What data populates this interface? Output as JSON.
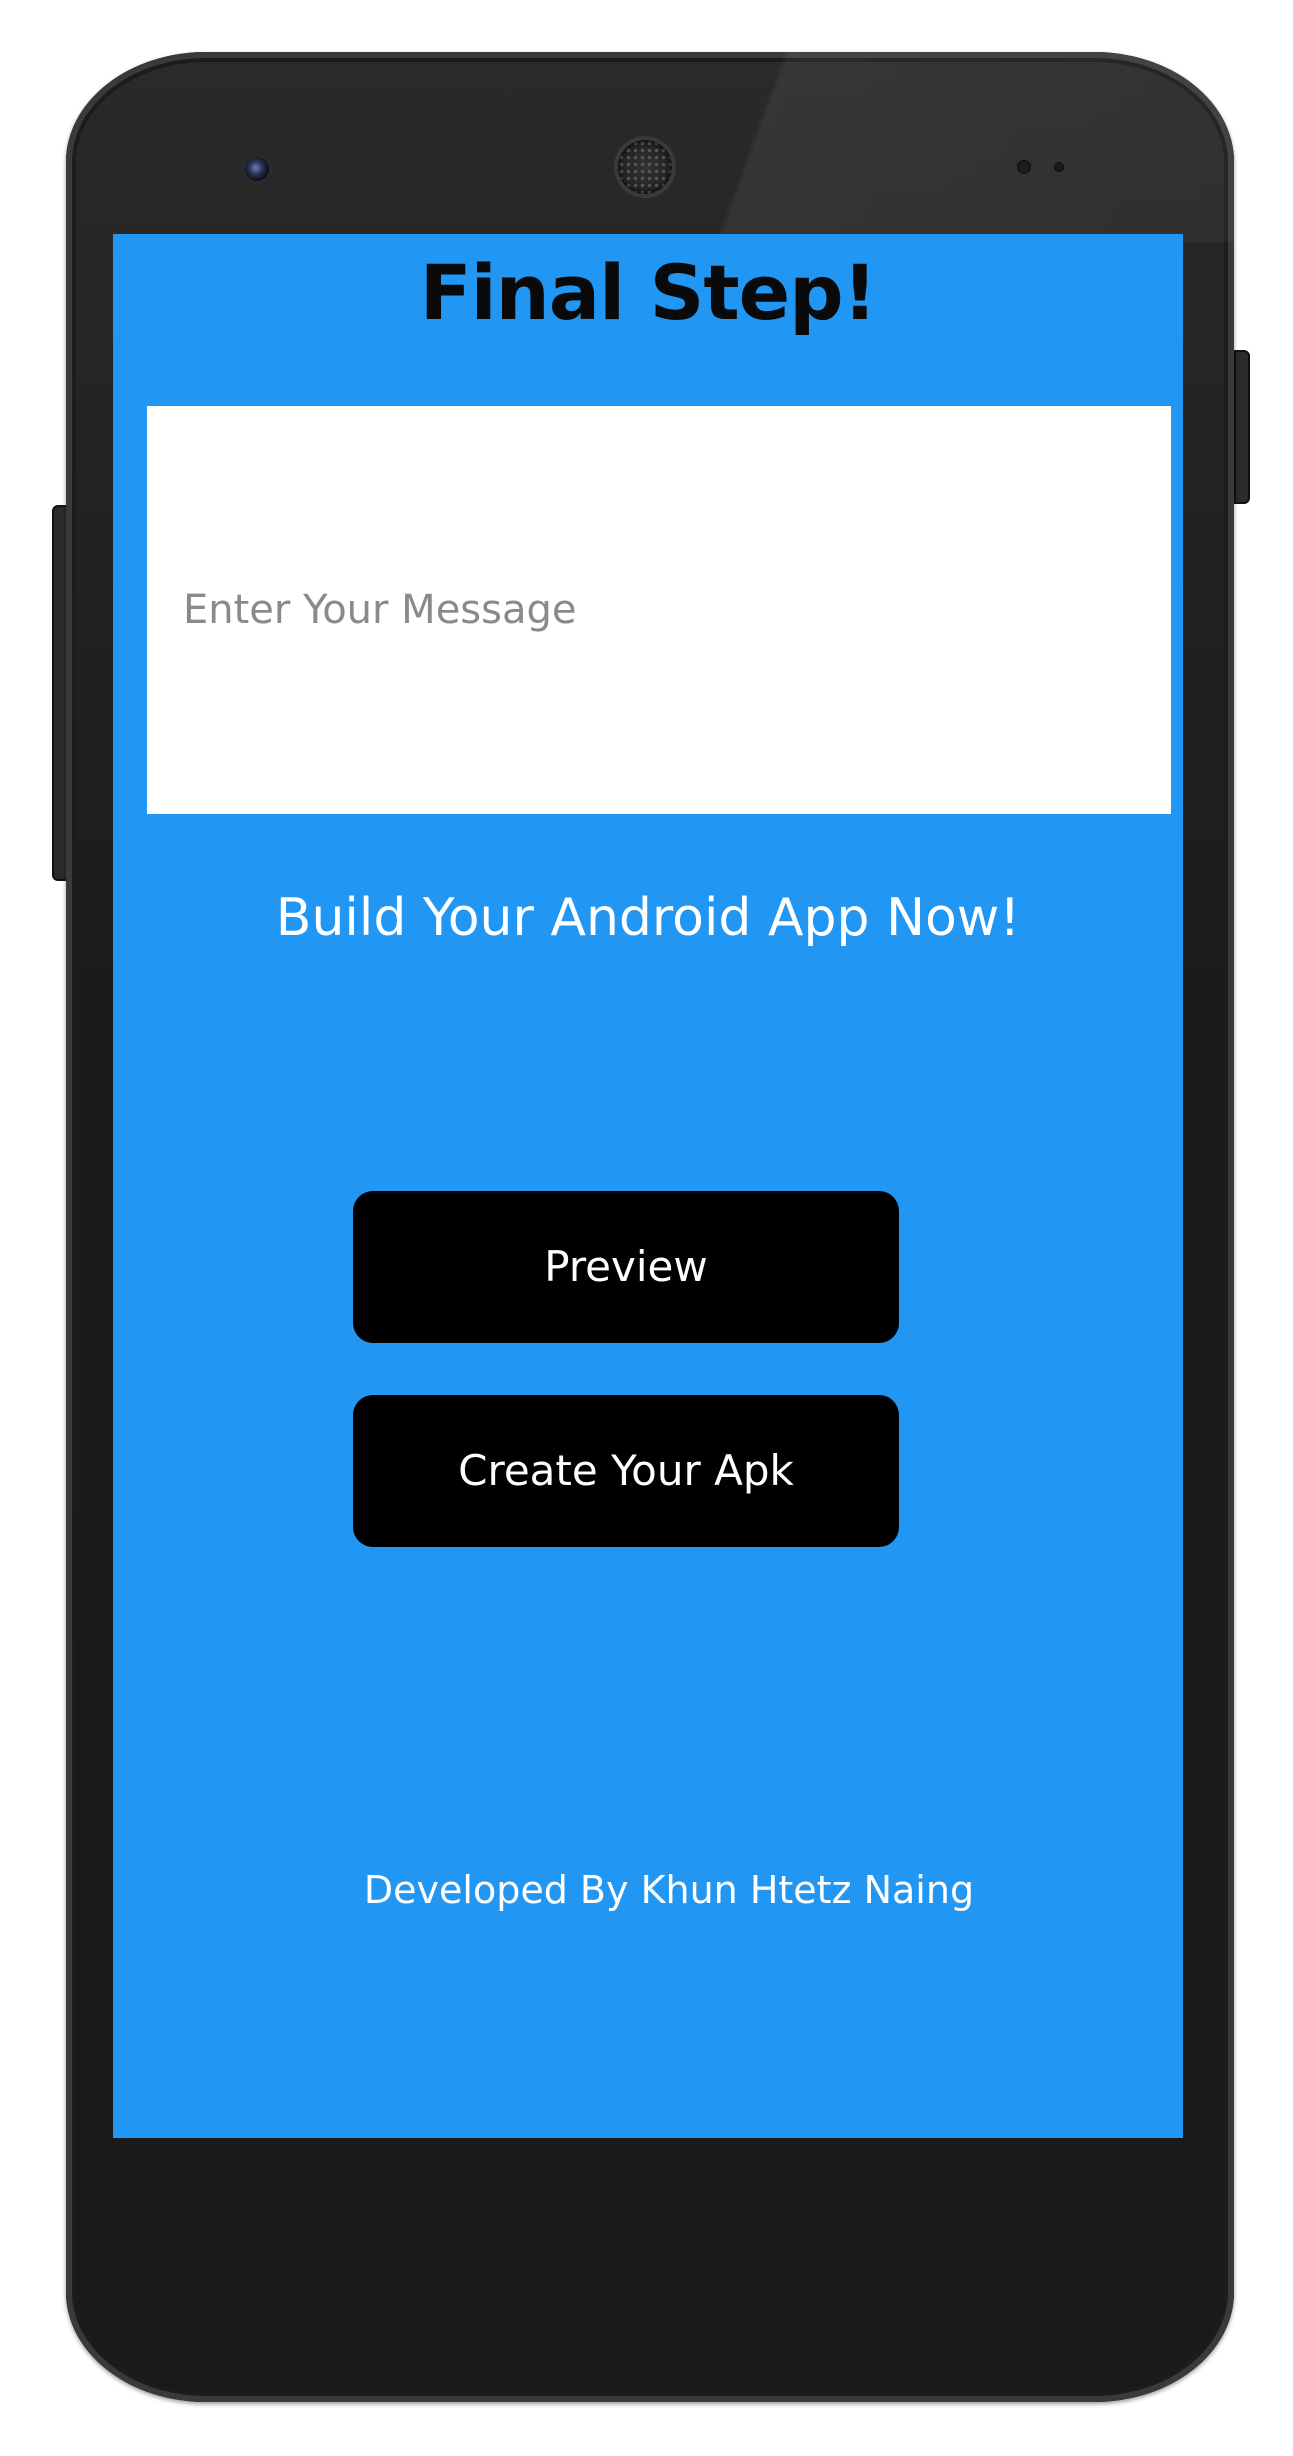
{
  "screen": {
    "title": "Final Step!",
    "message_input": {
      "value": "",
      "placeholder": "Enter Your Message"
    },
    "subtitle": "Build Your Android App Now!",
    "preview_button": "Preview",
    "create_apk_button": "Create Your Apk",
    "credit": "Developed By Khun Htetz Naing"
  },
  "colors": {
    "screen_background": "#2196f3",
    "button_background": "#000000",
    "button_text": "#ffffff",
    "title_text": "#0a0a0a",
    "input_background": "#ffffff",
    "placeholder_text": "#8a8a8a"
  },
  "device": {
    "frame": "Nexus 5 style phone frame"
  }
}
